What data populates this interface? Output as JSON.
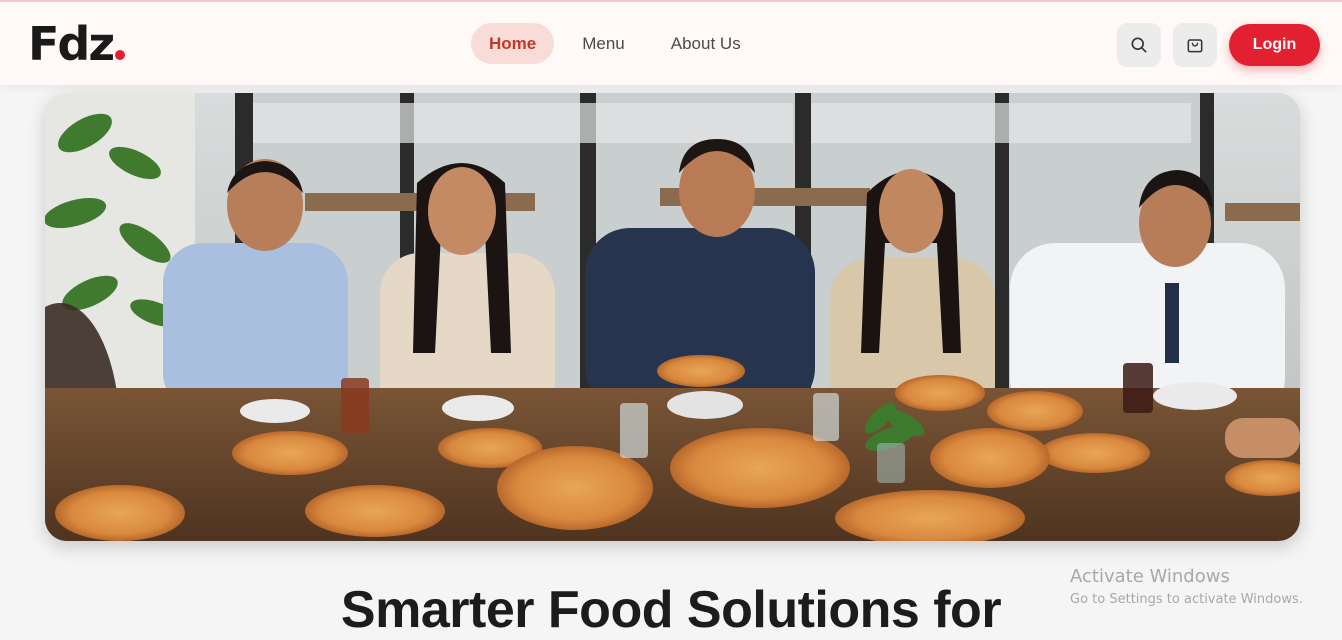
{
  "brand": {
    "logo_text": "Fdz",
    "accent_color": "#e3202f"
  },
  "nav": {
    "items": [
      {
        "label": "Home",
        "active": true
      },
      {
        "label": "Menu",
        "active": false
      },
      {
        "label": "About Us",
        "active": false
      }
    ]
  },
  "header_actions": {
    "search_icon": "search-icon",
    "cart_icon": "shopping-bag-icon",
    "login_label": "Login"
  },
  "hero": {
    "image_subject": "team of coworkers laughing and sharing pizzas around an office table"
  },
  "headline": "Smarter Food Solutions for",
  "watermark": {
    "title": "Activate Windows",
    "subtitle": "Go to Settings to activate Windows."
  }
}
